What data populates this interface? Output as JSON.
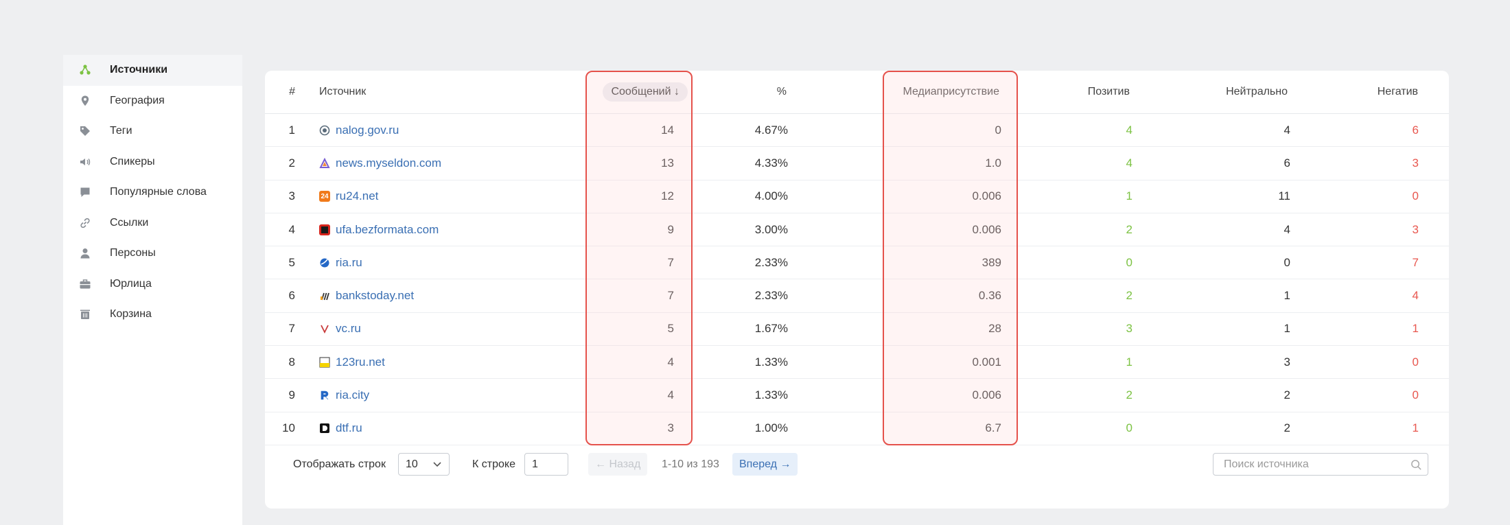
{
  "sidebar": {
    "items": [
      {
        "label": "Источники",
        "icon": "sources-icon",
        "active": true
      },
      {
        "label": "География",
        "icon": "location-pin-icon"
      },
      {
        "label": "Теги",
        "icon": "tag-icon"
      },
      {
        "label": "Спикеры",
        "icon": "speaker-icon"
      },
      {
        "label": "Популярные слова",
        "icon": "chat-bubble-icon"
      },
      {
        "label": "Ссылки",
        "icon": "link-icon"
      },
      {
        "label": "Персоны",
        "icon": "person-icon"
      },
      {
        "label": "Юрлица",
        "icon": "briefcase-icon"
      },
      {
        "label": "Корзина",
        "icon": "trash-icon"
      }
    ]
  },
  "table": {
    "headers": {
      "num": "#",
      "source": "Источник",
      "messages": "Сообщений ↓",
      "percent": "%",
      "media": "Медиаприсутствие",
      "positive": "Позитив",
      "neutral": "Нейтрально",
      "negative": "Негатив"
    },
    "rows": [
      {
        "num": "1",
        "source": "nalog.gov.ru",
        "messages": "14",
        "percent": "4.67%",
        "media": "0",
        "positive": "4",
        "neutral": "4",
        "negative": "6"
      },
      {
        "num": "2",
        "source": "news.myseldon.com",
        "messages": "13",
        "percent": "4.33%",
        "media": "1.0",
        "positive": "4",
        "neutral": "6",
        "negative": "3"
      },
      {
        "num": "3",
        "source": "ru24.net",
        "messages": "12",
        "percent": "4.00%",
        "media": "0.006",
        "positive": "1",
        "neutral": "11",
        "negative": "0"
      },
      {
        "num": "4",
        "source": "ufa.bezformata.com",
        "messages": "9",
        "percent": "3.00%",
        "media": "0.006",
        "positive": "2",
        "neutral": "4",
        "negative": "3"
      },
      {
        "num": "5",
        "source": "ria.ru",
        "messages": "7",
        "percent": "2.33%",
        "media": "389",
        "positive": "0",
        "neutral": "0",
        "negative": "7"
      },
      {
        "num": "6",
        "source": "bankstoday.net",
        "messages": "7",
        "percent": "2.33%",
        "media": "0.36",
        "positive": "2",
        "neutral": "1",
        "negative": "4"
      },
      {
        "num": "7",
        "source": "vc.ru",
        "messages": "5",
        "percent": "1.67%",
        "media": "28",
        "positive": "3",
        "neutral": "1",
        "negative": "1"
      },
      {
        "num": "8",
        "source": "123ru.net",
        "messages": "4",
        "percent": "1.33%",
        "media": "0.001",
        "positive": "1",
        "neutral": "3",
        "negative": "0"
      },
      {
        "num": "9",
        "source": "ria.city",
        "messages": "4",
        "percent": "1.33%",
        "media": "0.006",
        "positive": "2",
        "neutral": "2",
        "negative": "0"
      },
      {
        "num": "10",
        "source": "dtf.ru",
        "messages": "3",
        "percent": "1.00%",
        "media": "6.7",
        "positive": "0",
        "neutral": "2",
        "negative": "1"
      }
    ]
  },
  "footer": {
    "rows_label": "Отображать строк",
    "rows_value": "10",
    "goto_label": "К строке",
    "goto_value": "1",
    "prev_label": "← Назад",
    "range_info": "1-10 из 193",
    "next_label": "Вперед →",
    "search_placeholder": "Поиск источника"
  },
  "colors": {
    "positive": "#7cc243",
    "negative": "#e8574f",
    "link": "#3a6fb3",
    "highlight_border": "#e5514b"
  }
}
